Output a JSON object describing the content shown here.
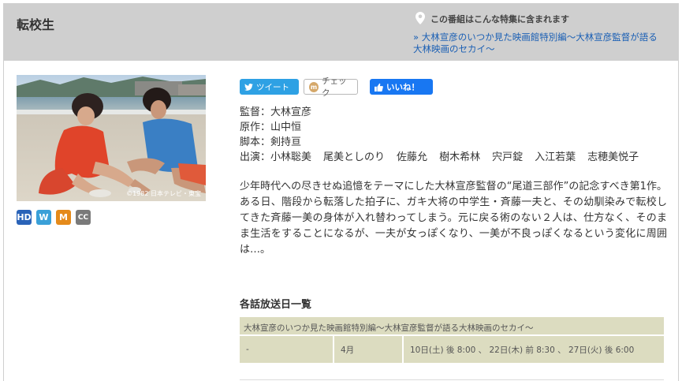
{
  "program": {
    "title": "転校生"
  },
  "special": {
    "heading": "この番組はこんな特集に含まれます",
    "link": "» 大林宣彦のいつか見た映画館特別編～大林宣彦監督が語る大林映画のセカイ～"
  },
  "thumbnail": {
    "copyright": "©1982 日本テレビ・東宝"
  },
  "badges": [
    {
      "label": "HD",
      "color": "#2a63b8"
    },
    {
      "label": "W",
      "color": "#3aa0d8"
    },
    {
      "label": "M",
      "color": "#e58a1a"
    },
    {
      "label": "CC",
      "color": "#7a7a7a"
    }
  ],
  "social": {
    "tweet": "ツイート",
    "check": "チェック",
    "like": "いいね！"
  },
  "credits": {
    "director": "監督：大林宣彦",
    "original": "原作：山中恒",
    "screenplay": "脚本：剣持亘",
    "cast_label": "出演：",
    "cast": [
      "小林聡美",
      "尾美としのり",
      "佐藤允",
      "樹木希林",
      "宍戸錠",
      "入江若葉",
      "志穂美悦子"
    ]
  },
  "synopsis": "少年時代への尽きせぬ追憶をテーマにした大林宣彦監督の“尾道三部作”の記念すべき第1作。ある日、階段から転落した拍子に、ガキ大将の中学生・斉藤一夫と、その幼馴染みで転校してきた斉藤一美の身体が入れ替わってしまう。元に戻る術のない２人は、仕方なく、そのまま生活をすることになるが、一夫が女っぽくなり、一美が不良っぽくなるという変化に周囲は…。",
  "schedule": {
    "title": "各話放送日一覧",
    "program_name": "大林宣彦のいつか見た映画館特別編～大林宣彦監督が語る大林映画のセカイ～",
    "rows": [
      {
        "episode": "-",
        "month": "4月",
        "dates": "10日(土) 後 8:00 、 22日(木) 前 8:30 、 27日(火) 後 6:00"
      }
    ]
  }
}
